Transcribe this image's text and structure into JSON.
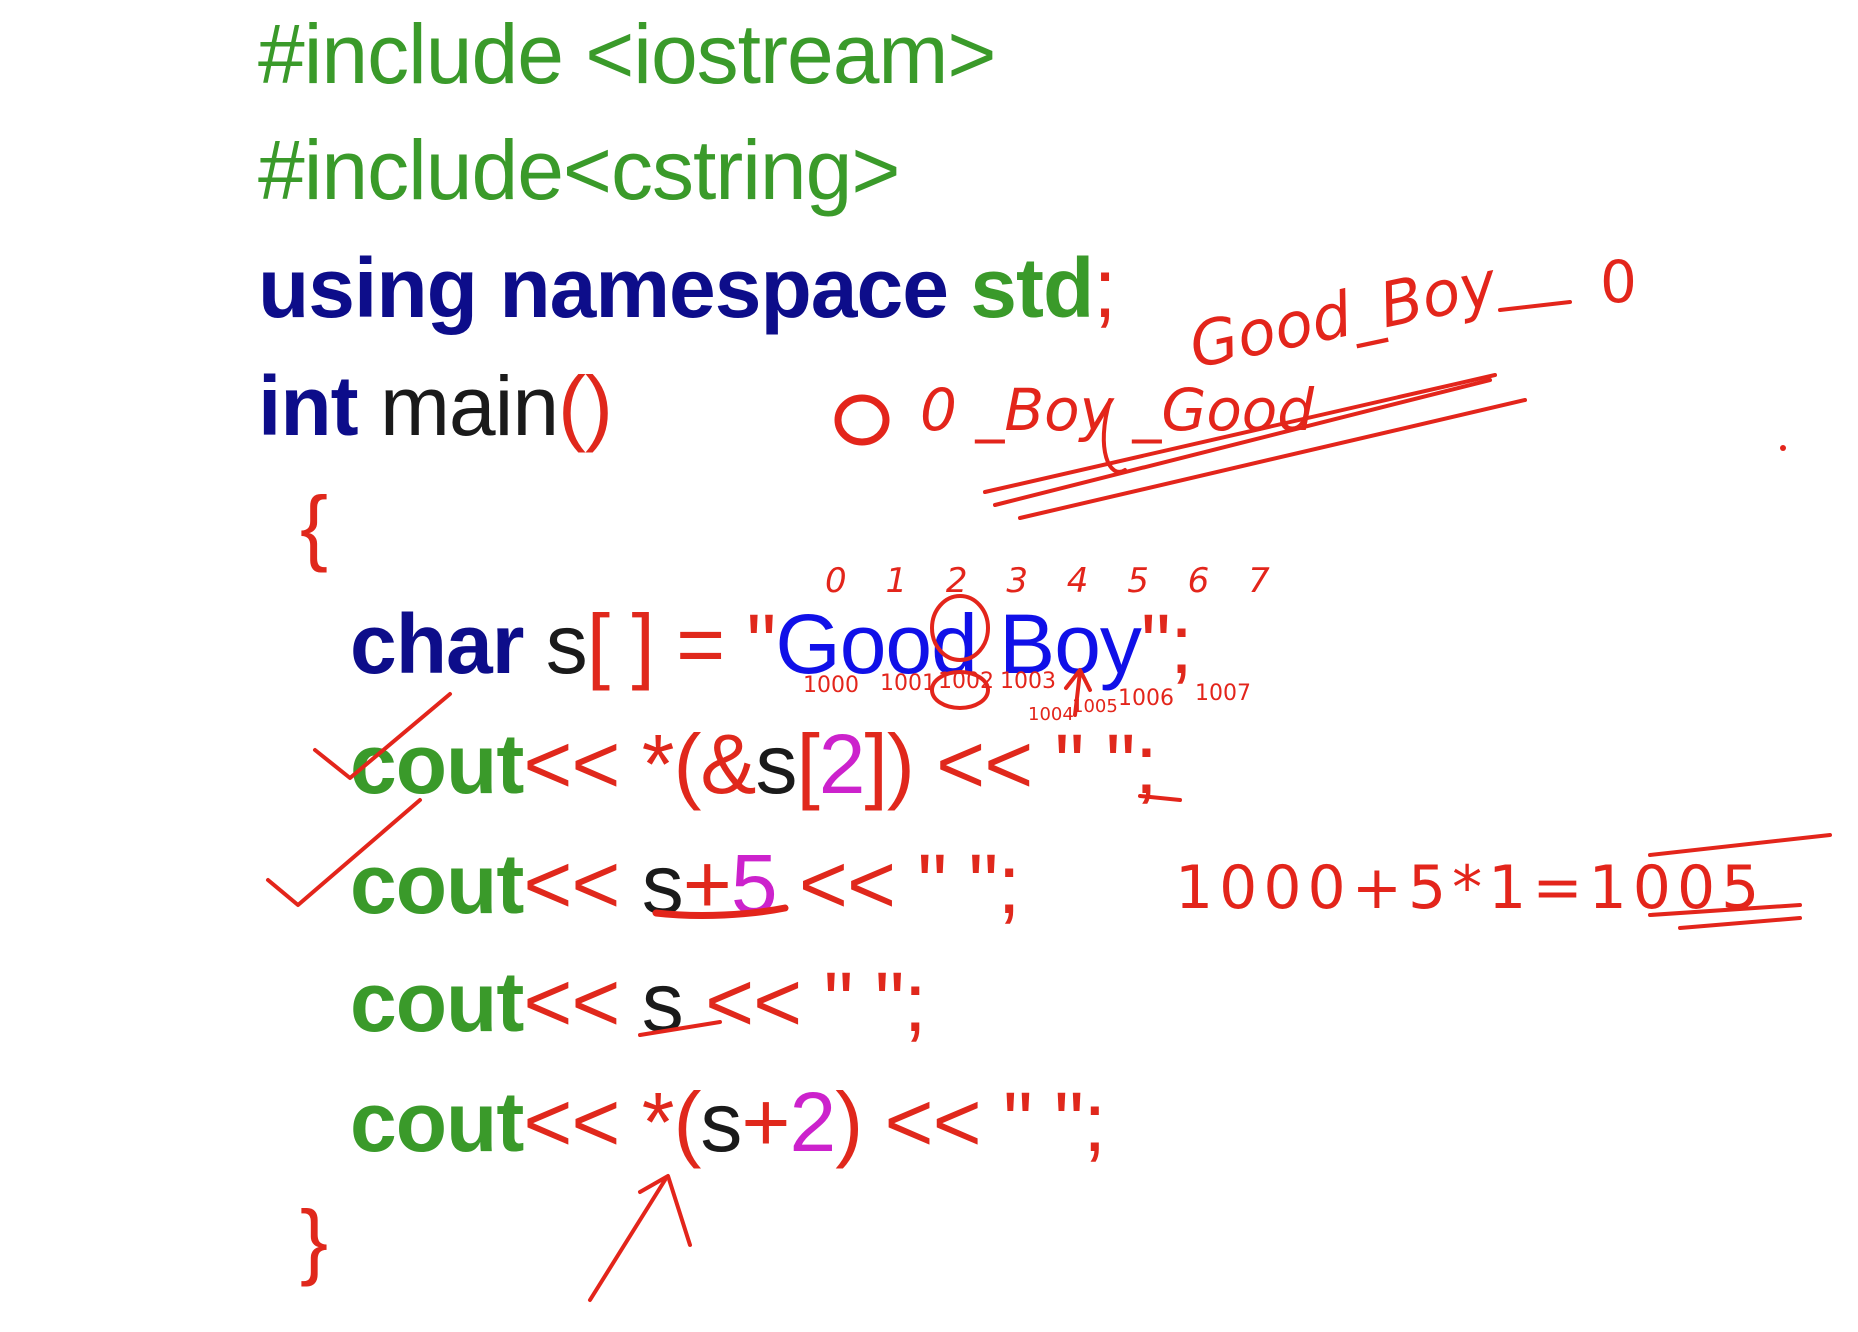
{
  "code": {
    "line1": "#include <iostream>",
    "line2": "#include<cstring>",
    "line3": {
      "kw": "using namespace",
      "std": "std",
      "semi": ";"
    },
    "line4": {
      "kw": "int",
      "name": " main",
      "parens": "()"
    },
    "line5": "{",
    "line6": {
      "kw": "char",
      "var": " s",
      "br": "[ ]",
      "eq": " = ",
      "q1": "\"",
      "str": "Good Boy",
      "q2": "\"",
      "semi": ";"
    },
    "line7": {
      "kw": "cout",
      "op": "<< *(&",
      "var": "s",
      "b1": "[",
      "num": "2",
      "b2": "])",
      "op2": " << ",
      "lit": "\" \"",
      "semi": ";"
    },
    "line8": {
      "kw": "cout",
      "op": "<< ",
      "var": "s",
      "plus": "+",
      "num": "5",
      "op2": " << ",
      "lit": "\" \"",
      "semi": ";"
    },
    "line9": {
      "kw": "cout",
      "op": "<< ",
      "var": "s",
      "op2": " << ",
      "lit": "\" \"",
      "semi": ";"
    },
    "line10": {
      "kw": "cout",
      "op": "<< *(",
      "var": "s",
      "plus": "+",
      "num": "2",
      "close": ")",
      "op2": " << ",
      "lit": "\" \"",
      "semi": ";"
    },
    "line11": "}"
  },
  "annotations": {
    "reversed_phrase": "0 _Boy _Good",
    "phrase": "Good_Boy",
    "terminator": "0",
    "indices": "0 1 2 3 4 5 6 7",
    "addresses": [
      "1000",
      "1001",
      "1002",
      "1003",
      "1004",
      "1005",
      "1006",
      "1007"
    ],
    "calc": "1000+5*1=1005",
    "ink_color": "#e3251b"
  }
}
